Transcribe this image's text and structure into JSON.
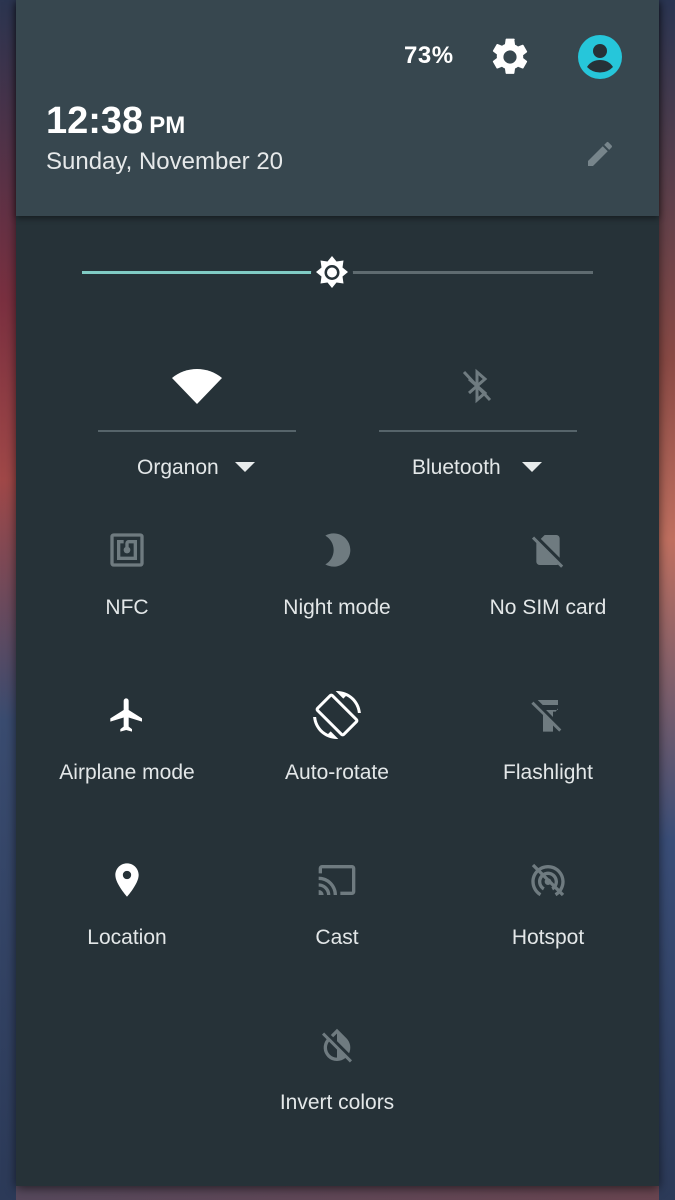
{
  "header": {
    "battery": "73%",
    "time": "12:38",
    "ampm": "PM",
    "date": "Sunday, November 20"
  },
  "brightness": {
    "level": 0.49
  },
  "big_tiles": [
    {
      "label": "Organon",
      "icon": "wifi-icon",
      "active": true
    },
    {
      "label": "Bluetooth",
      "icon": "bluetooth-disabled-icon",
      "active": false
    }
  ],
  "tiles": [
    {
      "label": "NFC",
      "icon": "nfc-icon",
      "active": false
    },
    {
      "label": "Night mode",
      "icon": "moon-icon",
      "active": false
    },
    {
      "label": "No SIM card",
      "icon": "no-sim-icon",
      "active": false
    },
    {
      "label": "Airplane mode",
      "icon": "airplane-icon",
      "active": true
    },
    {
      "label": "Auto-rotate",
      "icon": "screen-rotation-icon",
      "active": true
    },
    {
      "label": "Flashlight",
      "icon": "flashlight-off-icon",
      "active": false
    },
    {
      "label": "Location",
      "icon": "location-pin-icon",
      "active": true
    },
    {
      "label": "Cast",
      "icon": "cast-icon",
      "active": false
    },
    {
      "label": "Hotspot",
      "icon": "hotspot-off-icon",
      "active": false
    },
    {
      "label": "Invert colors",
      "icon": "invert-colors-off-icon",
      "active": false
    }
  ],
  "colors": {
    "panel": "#263238",
    "header": "#37474f",
    "accent": "#80cbc4",
    "avatar": "#26c6da",
    "active_icon": "#ffffff",
    "inactive_icon": "#6f7b80"
  }
}
